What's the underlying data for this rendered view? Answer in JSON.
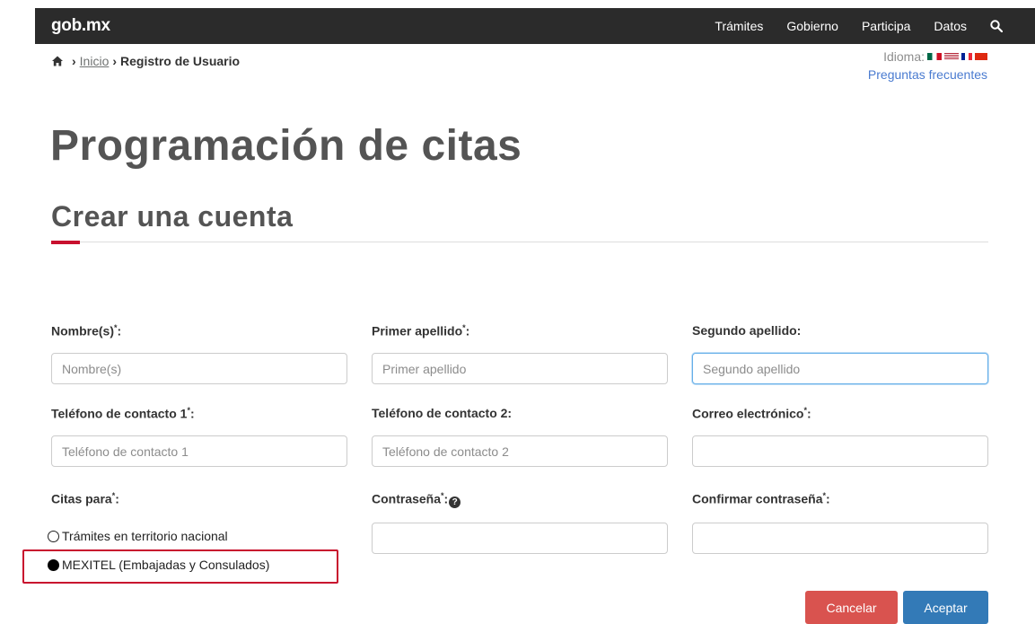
{
  "header": {
    "logo_main": "gob",
    "logo_dot": ".",
    "logo_suffix": "mx",
    "nav": [
      "Trámites",
      "Gobierno",
      "Participa",
      "Datos"
    ]
  },
  "breadcrumb": {
    "home_link": "Inicio",
    "current": "Registro de Usuario"
  },
  "language": {
    "label": "Idioma:"
  },
  "faq_link": "Preguntas frecuentes",
  "page_title": "Programación de citas",
  "section_title": "Crear una cuenta",
  "form": {
    "nombre": {
      "label": "Nombre(s)",
      "required": "*",
      "colon": ":",
      "placeholder": "Nombre(s)",
      "value": ""
    },
    "primer_apellido": {
      "label": "Primer apellido",
      "required": "*",
      "colon": ":",
      "placeholder": "Primer apellido",
      "value": ""
    },
    "segundo_apellido": {
      "label": "Segundo apellido:",
      "placeholder": "Segundo apellido",
      "value": ""
    },
    "telefono1": {
      "label": "Teléfono de contacto 1",
      "required": "*",
      "colon": ":",
      "placeholder": "Teléfono de contacto 1",
      "value": ""
    },
    "telefono2": {
      "label": "Teléfono de contacto 2:",
      "placeholder": "Teléfono de contacto 2",
      "value": ""
    },
    "correo": {
      "label": "Correo electrónico",
      "required": "*",
      "colon": ":",
      "placeholder": "",
      "value": ""
    },
    "citas_para": {
      "label": "Citas para",
      "required": "*",
      "colon": ":",
      "options": [
        "Trámites en territorio nacional",
        "MEXITEL (Embajadas y Consulados)"
      ],
      "selected_index": 1
    },
    "contrasena": {
      "label": "Contraseña",
      "required": "*",
      "colon": ":",
      "help_glyph": "?",
      "value": ""
    },
    "confirmar": {
      "label": "Confirmar contraseña",
      "required": "*",
      "colon": ":",
      "value": ""
    }
  },
  "buttons": {
    "cancel": "Cancelar",
    "accept": "Aceptar"
  },
  "colors": {
    "topbar": "#2b2b2b",
    "accent_red": "#c8102e",
    "cancel": "#d9534f",
    "accept": "#337ab7",
    "link_blue": "#4a7bd0"
  }
}
